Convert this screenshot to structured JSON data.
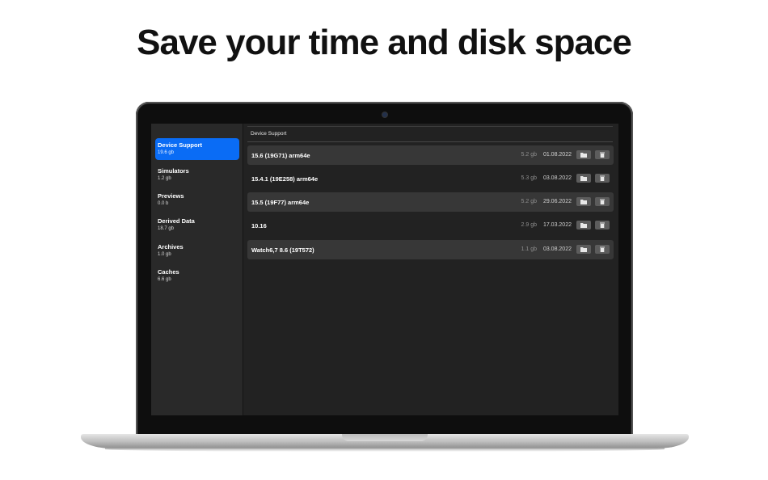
{
  "headline": "Save your time and disk space",
  "sidebar": {
    "items": [
      {
        "label": "Device Support",
        "size": "19.6 gb"
      },
      {
        "label": "Simulators",
        "size": "1.2 gb"
      },
      {
        "label": "Previews",
        "size": "0.0 b"
      },
      {
        "label": "Derived Data",
        "size": "18.7 gb"
      },
      {
        "label": "Archives",
        "size": "1.0 gb"
      },
      {
        "label": "Caches",
        "size": "6.6 gb"
      }
    ]
  },
  "content": {
    "header": "Device Support",
    "rows": [
      {
        "name": "15.6 (19G71) arm64e",
        "size": "5.2 gb",
        "date": "01.08.2022"
      },
      {
        "name": "15.4.1 (19E258) arm64e",
        "size": "5.3 gb",
        "date": "03.08.2022"
      },
      {
        "name": "15.5 (19F77) arm64e",
        "size": "5.2 gb",
        "date": "29.06.2022"
      },
      {
        "name": "10.16",
        "size": "2.9 gb",
        "date": "17.03.2022"
      },
      {
        "name": "Watch6,7 8.6 (19T572)",
        "size": "1.1 gb",
        "date": "03.08.2022"
      }
    ],
    "row_actions": {
      "open_icon": "folder-icon",
      "delete_icon": "trash-icon"
    }
  },
  "colors": {
    "accent": "#0a6cf5",
    "sidebar_bg": "#292929",
    "content_bg": "#222222",
    "row_shaded": "#373737"
  }
}
